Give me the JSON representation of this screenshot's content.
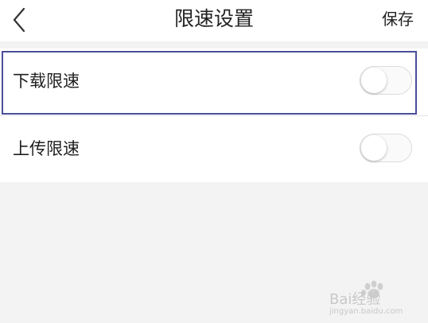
{
  "header": {
    "back_icon": "chevron-left-icon",
    "title": "限速设置",
    "save_label": "保存"
  },
  "settings": [
    {
      "label": "下载限速",
      "enabled": false,
      "highlighted": true
    },
    {
      "label": "上传限速",
      "enabled": false,
      "highlighted": false
    }
  ],
  "colors": {
    "background": "#f3f3f3",
    "card": "#ffffff",
    "highlight_border": "#4a4f9a",
    "toggle_border": "#dcdcdc"
  },
  "watermark": {
    "brand_text": "Bai经验",
    "url_text": "jingyan.baidu.com"
  }
}
